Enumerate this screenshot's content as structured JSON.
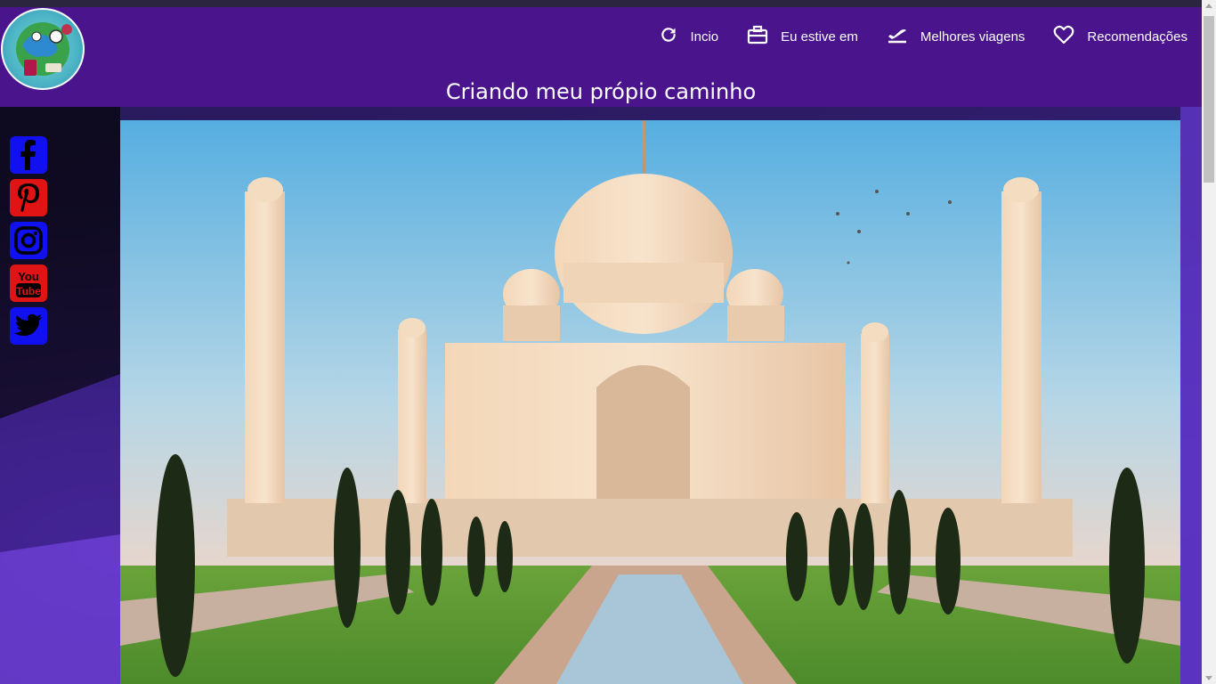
{
  "header": {
    "site_title": "Criando meu própio caminho",
    "background": "#4a148c"
  },
  "nav": {
    "items": [
      {
        "label": "Incio",
        "icon": "refresh-icon"
      },
      {
        "label": "Eu estive em",
        "icon": "briefcase-icon"
      },
      {
        "label": "Melhores viagens",
        "icon": "plane-takeoff-icon"
      },
      {
        "label": "Recomendações",
        "icon": "heart-icon"
      }
    ]
  },
  "social": [
    {
      "name": "facebook",
      "icon": "facebook-icon",
      "color": "#1010f0"
    },
    {
      "name": "pinterest",
      "icon": "pinterest-icon",
      "color": "#e01414"
    },
    {
      "name": "instagram",
      "icon": "instagram-icon",
      "color": "#1010f0"
    },
    {
      "name": "youtube",
      "icon": "youtube-icon",
      "color": "#e01414"
    },
    {
      "name": "twitter",
      "icon": "twitter-icon",
      "color": "#1010f0"
    }
  ],
  "hero": {
    "subject": "taj-mahal-photo"
  }
}
